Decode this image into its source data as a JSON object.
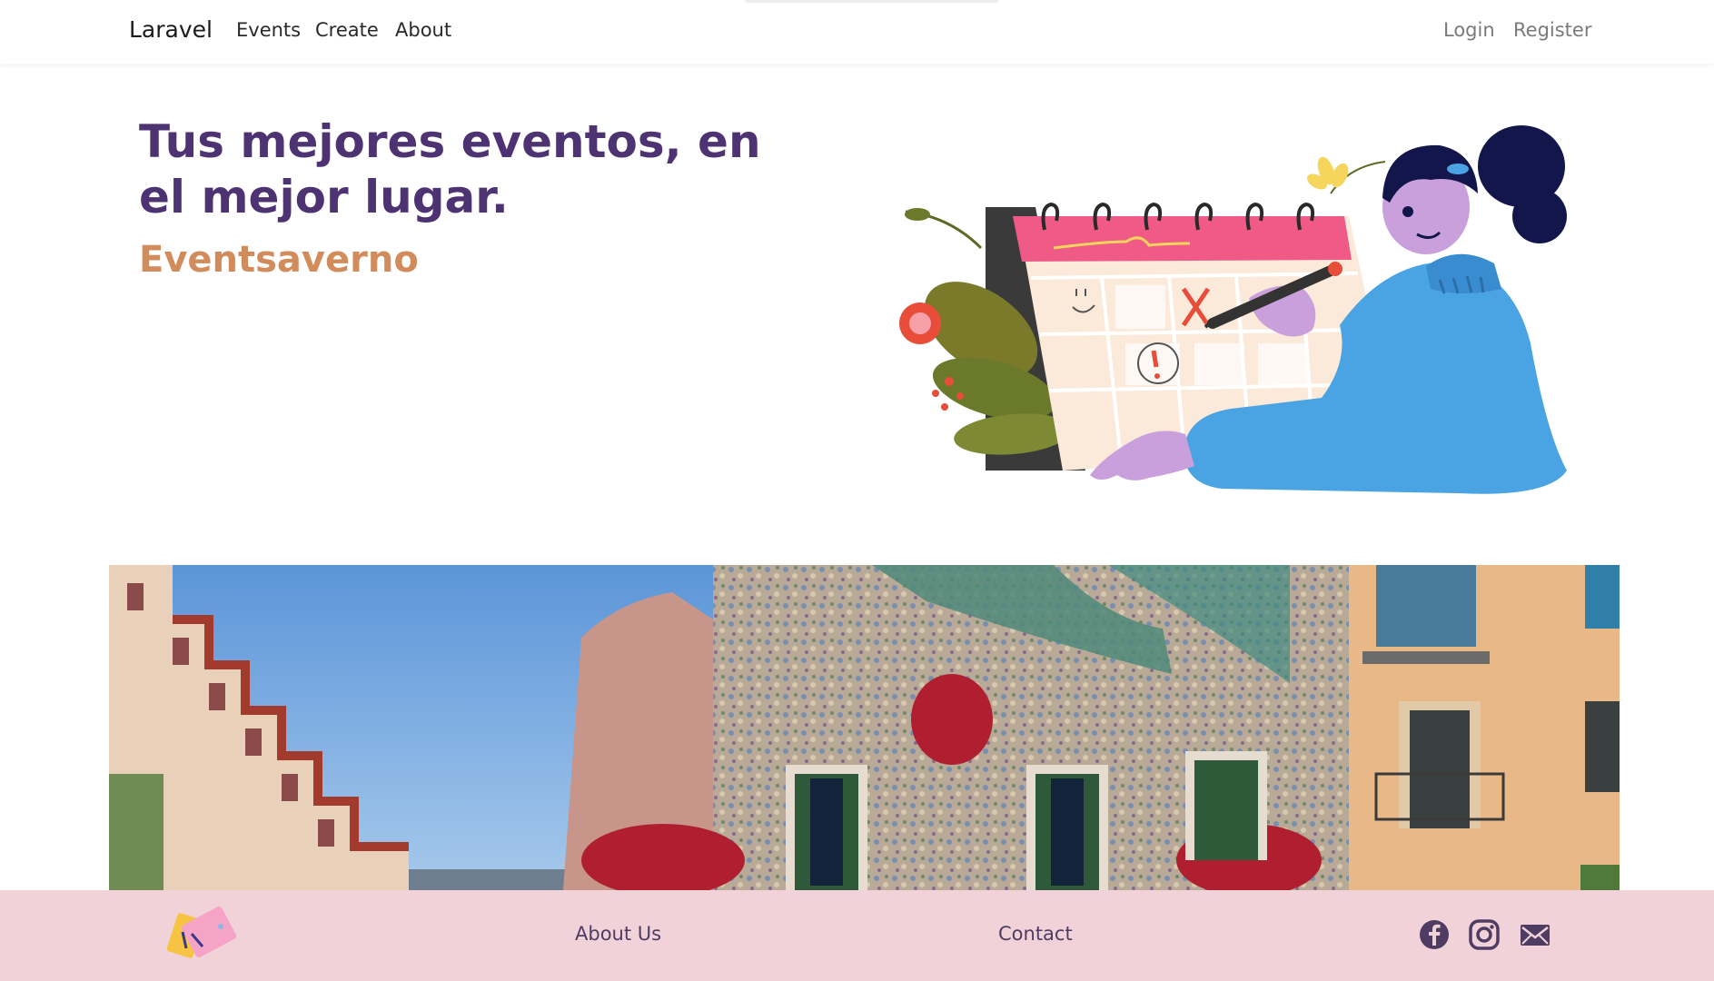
{
  "navbar": {
    "brand": "Laravel",
    "links": [
      "Events",
      "Create",
      "About"
    ],
    "auth": {
      "login": "Login",
      "register": "Register"
    }
  },
  "hero": {
    "title": "Tus mejores eventos, en el mejor lugar.",
    "subtitle": "Eventsaverno",
    "illustration_icon": "calendar-illustration"
  },
  "banner": {
    "image_icon": "casa-batllo-photo"
  },
  "footer": {
    "logo_icon": "tickets-logo-icon",
    "links": {
      "about": "About Us",
      "contact": "Contact"
    },
    "social": [
      "facebook-icon",
      "instagram-icon",
      "mail-icon"
    ]
  },
  "colors": {
    "title_purple": "#4e3373",
    "subtitle_orange": "#d28b5a",
    "footer_pink": "#f2d2d9",
    "social_purple": "#4e3c63"
  }
}
